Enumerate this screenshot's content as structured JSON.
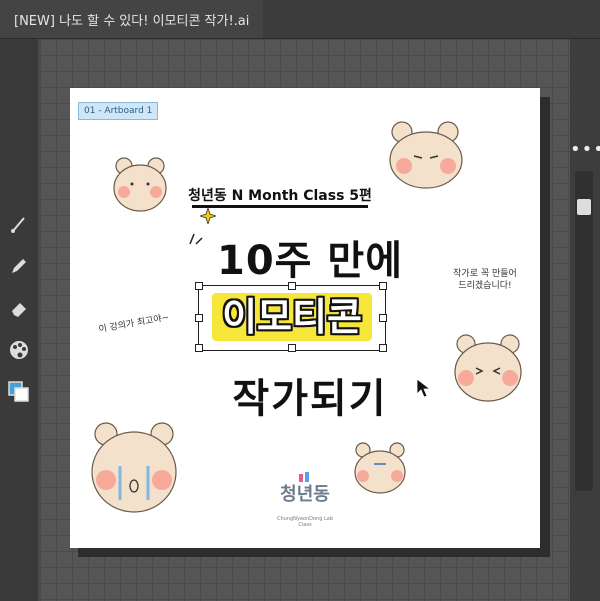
{
  "window": {
    "title": "[NEW] 나도 할 수 있다! 이모티콘 작가!.ai"
  },
  "artboard": {
    "label": "01 - Artboard 1"
  },
  "poster": {
    "subtitle": "청년동 N Month Class 5편",
    "line1": "10주 만에",
    "line2": "이모티콘",
    "line3": "작가되기",
    "note_left": "이 강의가 최고야~",
    "note_right": "작가로 꼭 만들어 드리겠습니다!",
    "logo_text": "청년동",
    "logo_sub": "ChungNyeonDong Lab Class",
    "highlight_color": "#f6e63a"
  },
  "toolbar": {
    "tools": [
      "brush-icon",
      "pencil-icon",
      "eraser-icon",
      "palette-icon",
      "swatches-icon"
    ]
  },
  "right_panel": {
    "menu": "•••"
  }
}
